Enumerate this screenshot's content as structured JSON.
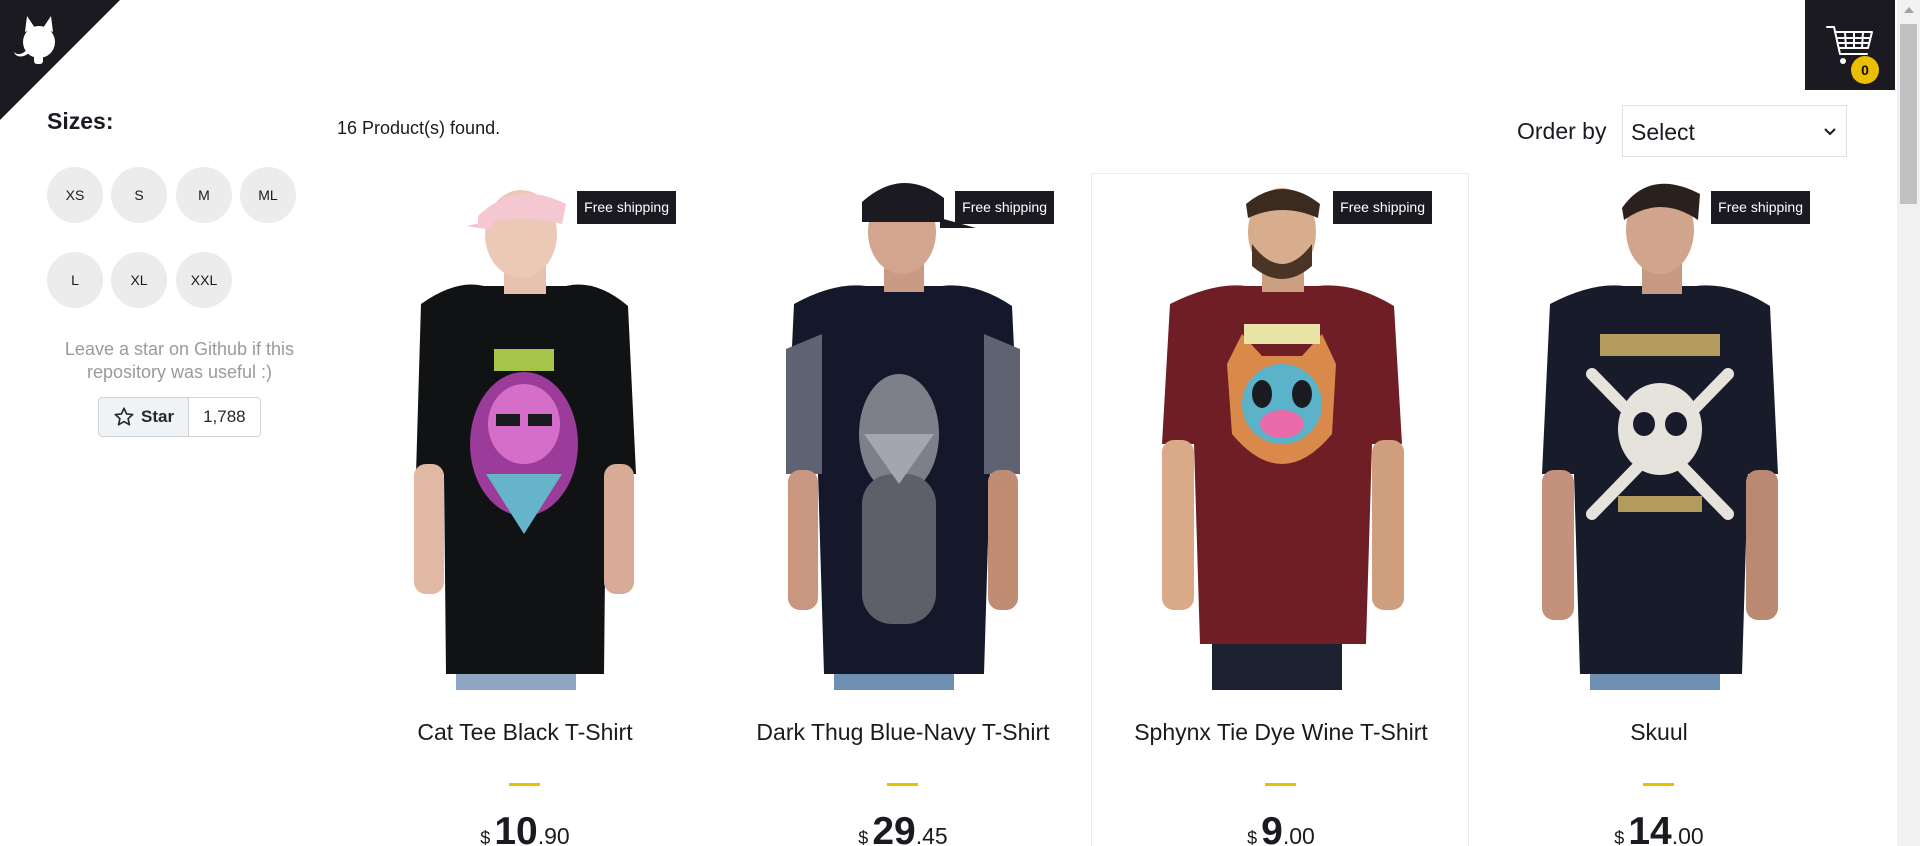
{
  "colors": {
    "accent": "#eabf00",
    "dark": "#1b1a20",
    "chip": "#ececec"
  },
  "github_corner": {
    "icon": "github-octocat-icon"
  },
  "cart": {
    "icon": "shopping-cart-icon",
    "count": "0"
  },
  "sidebar": {
    "sizes_title": "Sizes:",
    "sizes": [
      "XS",
      "S",
      "M",
      "ML",
      "L",
      "XL",
      "XXL"
    ],
    "star_message": "Leave a star on Github if this repository was useful :)",
    "star_button_label": "Star",
    "star_count": "1,788"
  },
  "shelf": {
    "products_found": "16 Product(s) found.",
    "order_label": "Order by",
    "order_value": "Select"
  },
  "products": [
    {
      "title": "Cat Tee Black T-Shirt",
      "badge": "Free shipping",
      "currency": "$",
      "price_int": "10",
      "price_dec": ".90",
      "shirt_color": "#111214",
      "print": "purple-lion-print"
    },
    {
      "title": "Dark Thug Blue-Navy T-Shirt",
      "badge": "Free shipping",
      "currency": "$",
      "price_int": "29",
      "price_dec": ".45",
      "shirt_color": "#14182a",
      "print": "bandana-figure-print"
    },
    {
      "title": "Sphynx Tie Dye Wine T-Shirt",
      "badge": "Free shipping",
      "currency": "$",
      "price_int": "9",
      "price_dec": ".00",
      "shirt_color": "#6e1e24",
      "print": "tie-dye-cat-print"
    },
    {
      "title": "Skuul",
      "badge": "Free shipping",
      "currency": "$",
      "price_int": "14",
      "price_dec": ".00",
      "shirt_color": "#181b29",
      "print": "skull-crossbones-print"
    }
  ]
}
